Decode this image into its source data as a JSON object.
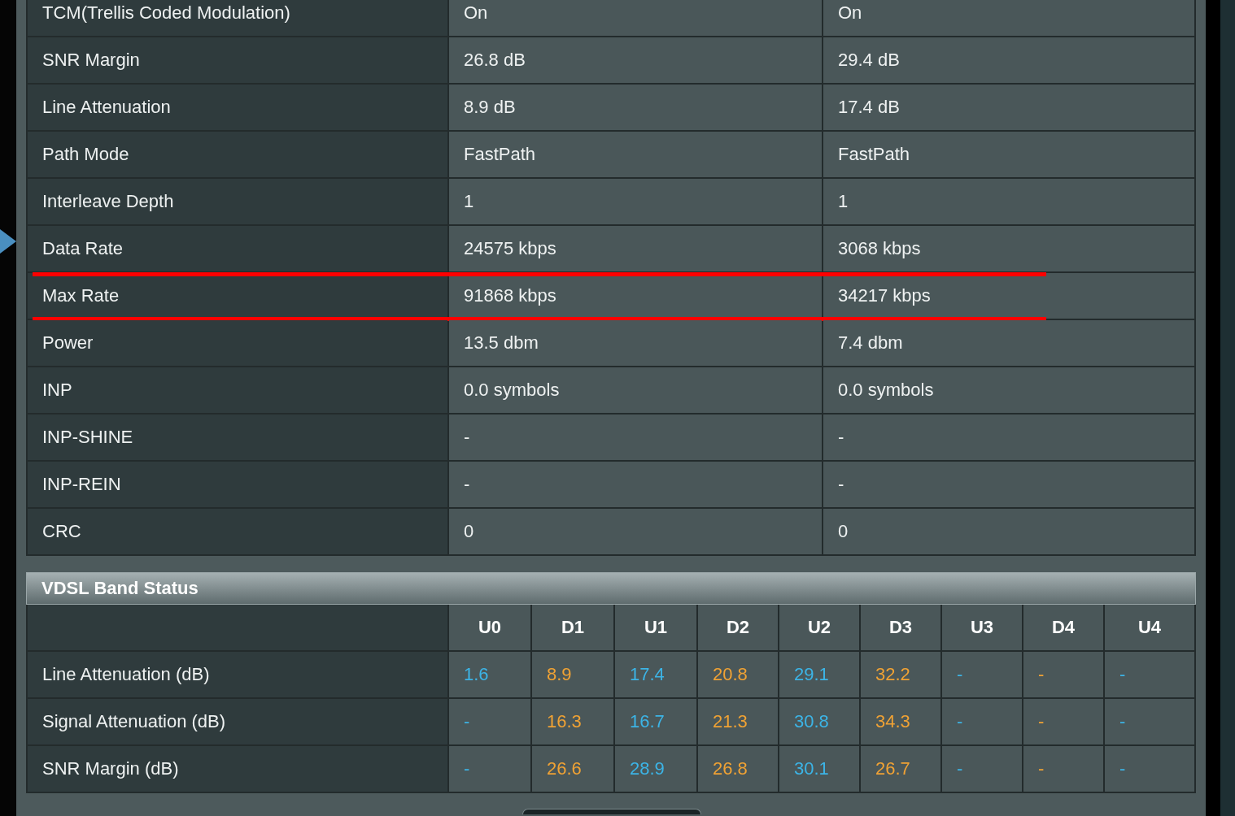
{
  "status_table": {
    "rows": [
      {
        "label": "TCM(Trellis Coded Modulation)",
        "downstream": "On",
        "upstream": "On",
        "marked": false
      },
      {
        "label": "SNR Margin",
        "downstream": "26.8 dB",
        "upstream": "29.4 dB",
        "marked": false
      },
      {
        "label": "Line Attenuation",
        "downstream": "8.9 dB",
        "upstream": "17.4 dB",
        "marked": false
      },
      {
        "label": "Path Mode",
        "downstream": "FastPath",
        "upstream": "FastPath",
        "marked": false
      },
      {
        "label": "Interleave Depth",
        "downstream": "1",
        "upstream": "1",
        "marked": false
      },
      {
        "label": "Data Rate",
        "downstream": "24575 kbps",
        "upstream": "3068 kbps",
        "marked": false
      },
      {
        "label": "Max Rate",
        "downstream": "91868 kbps",
        "upstream": "34217 kbps",
        "marked": true
      },
      {
        "label": "Power",
        "downstream": "13.5 dbm",
        "upstream": "7.4 dbm",
        "marked": false
      },
      {
        "label": "INP",
        "downstream": "0.0 symbols",
        "upstream": "0.0 symbols",
        "marked": false
      },
      {
        "label": "INP-SHINE",
        "downstream": "-",
        "upstream": "-",
        "marked": false
      },
      {
        "label": "INP-REIN",
        "downstream": "-",
        "upstream": "-",
        "marked": false
      },
      {
        "label": "CRC",
        "downstream": "0",
        "upstream": "0",
        "marked": false
      }
    ]
  },
  "band_status": {
    "title": "VDSL Band Status",
    "columns": [
      {
        "label": "U0",
        "color": "#3cb4e6"
      },
      {
        "label": "D1",
        "color": "#f0a234"
      },
      {
        "label": "U1",
        "color": "#3cb4e6"
      },
      {
        "label": "D2",
        "color": "#f0a234"
      },
      {
        "label": "U2",
        "color": "#3cb4e6"
      },
      {
        "label": "D3",
        "color": "#f0a234"
      },
      {
        "label": "U3",
        "color": "#3cb4e6"
      },
      {
        "label": "D4",
        "color": "#f0a234"
      },
      {
        "label": "U4",
        "color": "#3cb4e6"
      }
    ],
    "rows": [
      {
        "label": "Line Attenuation (dB)",
        "values": [
          "1.6",
          "8.9",
          "17.4",
          "20.8",
          "29.1",
          "32.2",
          "-",
          "-",
          "-"
        ]
      },
      {
        "label": "Signal Attenuation (dB)",
        "values": [
          "-",
          "16.3",
          "16.7",
          "21.3",
          "30.8",
          "34.3",
          "-",
          "-",
          "-"
        ]
      },
      {
        "label": "SNR Margin (dB)",
        "values": [
          "-",
          "26.6",
          "28.9",
          "26.8",
          "30.1",
          "26.7",
          "-",
          "-",
          "-"
        ]
      }
    ]
  }
}
